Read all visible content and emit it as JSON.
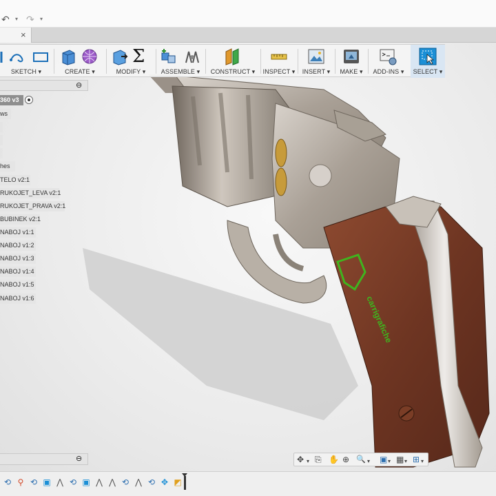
{
  "quick_access": {
    "undo_icon": "undo-icon",
    "redo_icon": "redo-icon"
  },
  "document_tab": {
    "close_glyph": "×"
  },
  "toolbar": {
    "groups": [
      {
        "label": "SKETCH ▾"
      },
      {
        "label": "CREATE ▾"
      },
      {
        "label": "MODIFY ▾",
        "sigma": "Σ"
      },
      {
        "label": "ASSEMBLE ▾"
      },
      {
        "label": "CONSTRUCT ▾"
      },
      {
        "label": "INSPECT ▾"
      },
      {
        "label": "INSERT ▾"
      },
      {
        "label": "MAKE ▾"
      },
      {
        "label": "ADD-INS ▾"
      },
      {
        "label": "SELECT ▾"
      }
    ]
  },
  "browser": {
    "collapse_glyph": "⊖",
    "items": [
      {
        "label": "360 v3"
      },
      {
        "label": "ws"
      },
      {
        "label": ""
      },
      {
        "label": ""
      },
      {
        "label": ""
      },
      {
        "label": "hes"
      },
      {
        "label": "TELO v2:1"
      },
      {
        "label": "RUKOJET_LEVA v2:1"
      },
      {
        "label": "RUKOJET_PRAVA v2:1"
      },
      {
        "label": "BUBINEK v2:1"
      },
      {
        "label": "NABOJ v1:1"
      },
      {
        "label": "NABOJ v1:2"
      },
      {
        "label": "NABOJ v1:3"
      },
      {
        "label": "NABOJ v1:4"
      },
      {
        "label": "NABOJ v1:5"
      },
      {
        "label": "NABOJ v1:6"
      }
    ]
  },
  "comments": {
    "collapse_glyph": "⊖"
  },
  "grip_engraving": "carrigrafiche",
  "nav_bar": {
    "icons": [
      "orbit-icon",
      "pan-icon",
      "zoom-icon",
      "fit-icon",
      "display-settings-icon",
      "grid-icon",
      "viewports-icon"
    ],
    "glyphs": {
      "orbit": "✥",
      "pan": "✋",
      "zoom_window": "⊕",
      "zoom": "🔍",
      "display": "▣",
      "grid": "▦",
      "viewports": "⊞",
      "caret": "▾"
    }
  },
  "timeline": {
    "glyph_count": 13
  },
  "colors": {
    "accent_select": "#1b8fd6",
    "grip_wood": "#7a3a26",
    "metal": "#b9b1a9",
    "engraving": "#3fb51e"
  }
}
